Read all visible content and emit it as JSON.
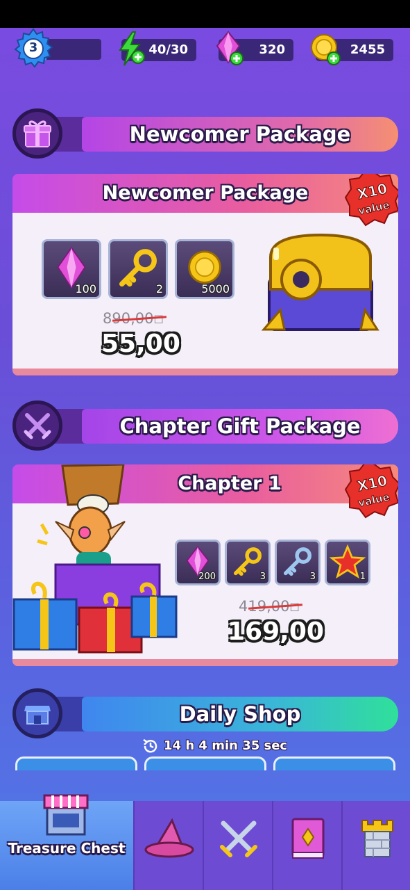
{
  "top": {
    "level": "3",
    "level_progress": 0.1,
    "energy": "40/30",
    "gems": "320",
    "coins": "2455"
  },
  "sections": {
    "newcomer_header": "Newcomer Package",
    "chapter_header": "Chapter Gift Package",
    "daily_header": "Daily Shop"
  },
  "newcomer_card": {
    "title": "Newcomer Package",
    "badge_top": "X10",
    "badge_bottom": "value",
    "items": [
      {
        "icon": "gem-icon",
        "count": "100"
      },
      {
        "icon": "key-icon",
        "count": "2"
      },
      {
        "icon": "coin-icon",
        "count": "5000"
      }
    ],
    "old_price": "890,00",
    "price": "55,00"
  },
  "chapter_card": {
    "title": "Chapter 1",
    "badge_top": "X10",
    "badge_bottom": "value",
    "items": [
      {
        "icon": "gem-icon",
        "count": "200"
      },
      {
        "icon": "gold-key-icon",
        "count": "3"
      },
      {
        "icon": "silver-key-icon",
        "count": "3"
      },
      {
        "icon": "star-icon",
        "count": "1"
      }
    ],
    "old_price": "419,00",
    "price": "169,00"
  },
  "daily_shop": {
    "timer": "14 h 4 min 35 sec"
  },
  "nav": {
    "items": [
      {
        "label": "Treasure Chest",
        "icon": "shop-icon",
        "active": true
      },
      {
        "label": "",
        "icon": "wizard-hat-icon"
      },
      {
        "label": "",
        "icon": "crossed-swords-icon"
      },
      {
        "label": "",
        "icon": "book-icon"
      },
      {
        "label": "",
        "icon": "tower-icon"
      }
    ]
  },
  "colors": {
    "bg_top": "#7a4be0",
    "bg_bottom": "#4f7ae6",
    "card_header": "#c54ce9",
    "gem": "#e24fd8",
    "coin": "#f5c518",
    "nav_active": "#5b8ff0"
  }
}
